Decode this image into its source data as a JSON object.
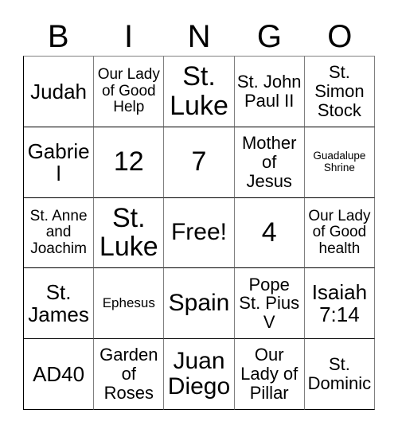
{
  "card": {
    "headers": [
      "B",
      "I",
      "N",
      "G",
      "O"
    ],
    "rows": [
      [
        {
          "text": "Judah",
          "size": "lg"
        },
        {
          "text": "Our Lady of Good Help",
          "size": "sm"
        },
        {
          "text": "St. Luke",
          "size": "xxl"
        },
        {
          "text": "St. John Paul II",
          "size": "md"
        },
        {
          "text": "St. Simon Stock",
          "size": "md"
        }
      ],
      [
        {
          "text": "Gabriel",
          "size": "lg"
        },
        {
          "text": "12",
          "size": "xxl"
        },
        {
          "text": "7",
          "size": "xxl"
        },
        {
          "text": "Mother of Jesus",
          "size": "md"
        },
        {
          "text": "Guadalupe Shrine",
          "size": "xxs"
        }
      ],
      [
        {
          "text": "St. Anne and Joachim",
          "size": "sm"
        },
        {
          "text": "St. Luke",
          "size": "xxl"
        },
        {
          "text": "Free!",
          "size": "xl"
        },
        {
          "text": "4",
          "size": "xxl"
        },
        {
          "text": "Our Lady of Good health",
          "size": "sm"
        }
      ],
      [
        {
          "text": "St. James",
          "size": "lg"
        },
        {
          "text": "Ephesus",
          "size": "xs"
        },
        {
          "text": "Spain",
          "size": "xl"
        },
        {
          "text": "Pope St. Pius V",
          "size": "md"
        },
        {
          "text": "Isaiah 7:14",
          "size": "lg"
        }
      ],
      [
        {
          "text": "AD40",
          "size": "lg"
        },
        {
          "text": "Garden of Roses",
          "size": "md"
        },
        {
          "text": "Juan Diego",
          "size": "xl"
        },
        {
          "text": "Our Lady of Pillar",
          "size": "md"
        },
        {
          "text": "St. Dominic",
          "size": "md"
        }
      ]
    ]
  },
  "colors": {
    "background": "#ffffff",
    "text": "#000000",
    "grid_line": "#808080",
    "grid_line_dark": "#000000"
  }
}
